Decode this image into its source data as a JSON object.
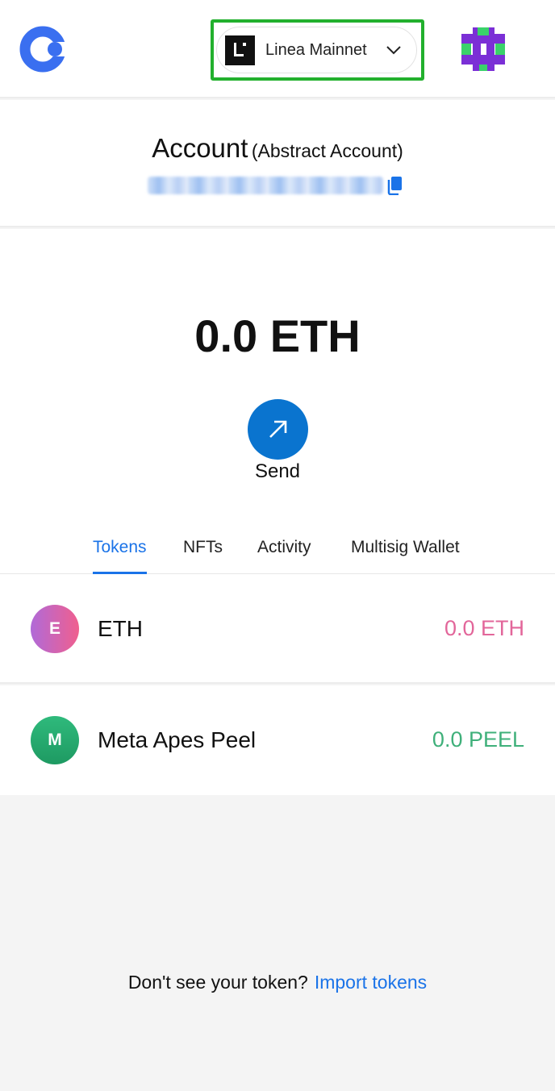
{
  "header": {
    "network_name": "Linea Mainnet",
    "logo_icon": "app-logo-icon",
    "network_icon": "linea-logo-icon",
    "chevron_icon": "chevron-down-icon",
    "avatar_icon": "account-avatar-icon",
    "highlight_color": "#22b02d"
  },
  "account": {
    "name": "Account",
    "type": "(Abstract Account)",
    "copy_icon": "copy-icon"
  },
  "wallet": {
    "balance": "0.0 ETH",
    "send_label": "Send",
    "send_icon": "arrow-up-right-icon",
    "accent_color": "#0a74cf"
  },
  "tabs": [
    {
      "label": "Tokens",
      "active": true
    },
    {
      "label": "NFTs",
      "active": false
    },
    {
      "label": "Activity",
      "active": false
    },
    {
      "label": "Multisig Wallet",
      "active": false
    }
  ],
  "tokens": [
    {
      "initial": "E",
      "name": "ETH",
      "balance": "0.0 ETH",
      "balance_color": "#e2669a"
    },
    {
      "initial": "M",
      "name": "Meta Apes Peel",
      "balance": "0.0 PEEL",
      "balance_color": "#3fb07a"
    }
  ],
  "footer": {
    "prompt": "Don't see your token?",
    "link": "Import tokens"
  }
}
